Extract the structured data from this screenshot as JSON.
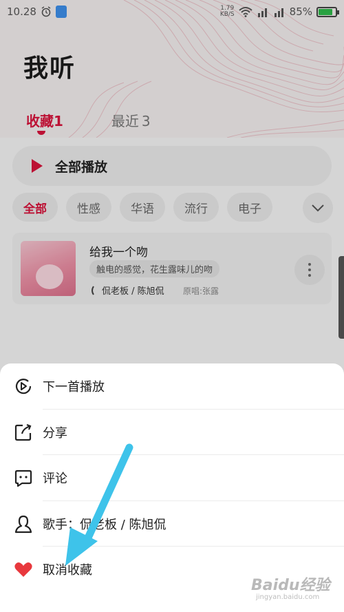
{
  "statusbar": {
    "time": "10.28",
    "net_speed_value": "1.79",
    "net_speed_unit": "KB/S",
    "battery": "85%",
    "battery_level": 0.85
  },
  "page": {
    "title": "我听"
  },
  "tabs": [
    {
      "label": "收藏",
      "count": "1",
      "active": true
    },
    {
      "label": "最近",
      "count": "3",
      "active": false
    }
  ],
  "play_all": {
    "label": "全部播放"
  },
  "chips": [
    {
      "label": "全部",
      "active": true
    },
    {
      "label": "性感",
      "active": false
    },
    {
      "label": "华语",
      "active": false
    },
    {
      "label": "流行",
      "active": false
    },
    {
      "label": "电子",
      "active": false
    }
  ],
  "song": {
    "title": "给我一个吻",
    "description": "触电的感觉，花生露味儿的吻",
    "artist": "侃老板 / 陈旭侃",
    "original": "原唱:张露"
  },
  "sheet": {
    "items": [
      {
        "label": "下一首播放",
        "icon": "play-next-icon"
      },
      {
        "label": "分享",
        "icon": "share-icon"
      },
      {
        "label": "评论",
        "icon": "comment-icon"
      },
      {
        "label": "歌手：侃老板 / 陈旭侃",
        "icon": "artist-icon"
      },
      {
        "label": "取消收藏",
        "icon": "heart-icon"
      }
    ]
  },
  "watermark": {
    "text": "Baidu经验",
    "url": "jingyan.baidu.com"
  },
  "colors": {
    "accent": "#d6143c",
    "heart": "#e8383d",
    "arrow": "#3ec3ea"
  }
}
